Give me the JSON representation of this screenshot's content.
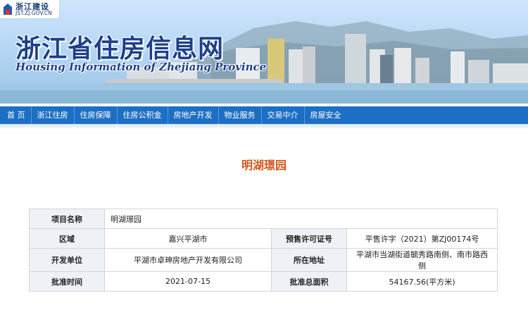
{
  "header": {
    "tag_name": "浙江建设",
    "tag_url": "JST.ZJ.GOV.CN",
    "site_title": "浙江省住房信息网",
    "site_subtitle": "Housing Information of Zhejiang Province"
  },
  "nav": {
    "items": [
      "首 页",
      "浙江住房",
      "住房保障",
      "住房公积金",
      "房地产开发",
      "物业服务",
      "交易中介",
      "房屋安全"
    ]
  },
  "page": {
    "title": "明湖璟园"
  },
  "project": {
    "name_label": "项目名称",
    "name_value": "明湖璟园",
    "area_label": "区域",
    "area_value": "嘉兴平湖市",
    "permit_label": "预售许可证号",
    "permit_value": "平售许字（2021）第ZJ00174号",
    "developer_label": "开发单位",
    "developer_value": "平湖市卓珅房地产开发有限公司",
    "address_label": "所在地址",
    "address_value": "平湖市当湖街道毓秀路南侧、南市路西侧",
    "date_label": "批准时间",
    "date_value": "2021-07-15",
    "total_area_label": "批准总面积",
    "total_area_value": "54167.56(平方米)"
  }
}
